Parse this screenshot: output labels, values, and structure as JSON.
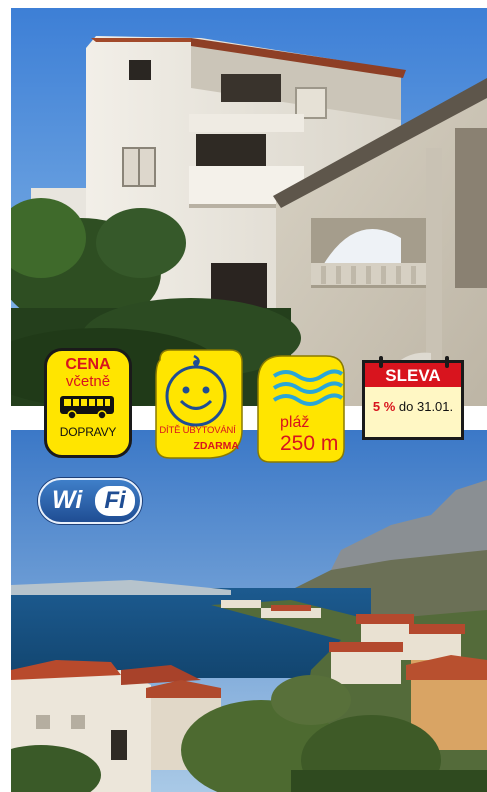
{
  "badges": {
    "cena": {
      "line1": "CENA",
      "line2": "včetně",
      "icon": "bus-icon",
      "line3": "DOPRAVY"
    },
    "dite": {
      "icon": "smiling-child-face-icon",
      "line1": "DÍTĚ UBYTOVÁNÍ",
      "line2": "ZDARMA"
    },
    "plaz": {
      "icon": "waves-icon",
      "line1": "pláž",
      "line2": "250 m"
    },
    "sleva": {
      "icon": "calendar-icon",
      "header": "SLEVA",
      "percent": "5 %",
      "until": "do 31.01."
    }
  },
  "wifi": {
    "part1": "Wi",
    "part2": "Fi"
  },
  "colors": {
    "badge_yellow": "#ffe500",
    "accent_red": "#d8141e",
    "wifi_blue": "#1f4d93"
  }
}
